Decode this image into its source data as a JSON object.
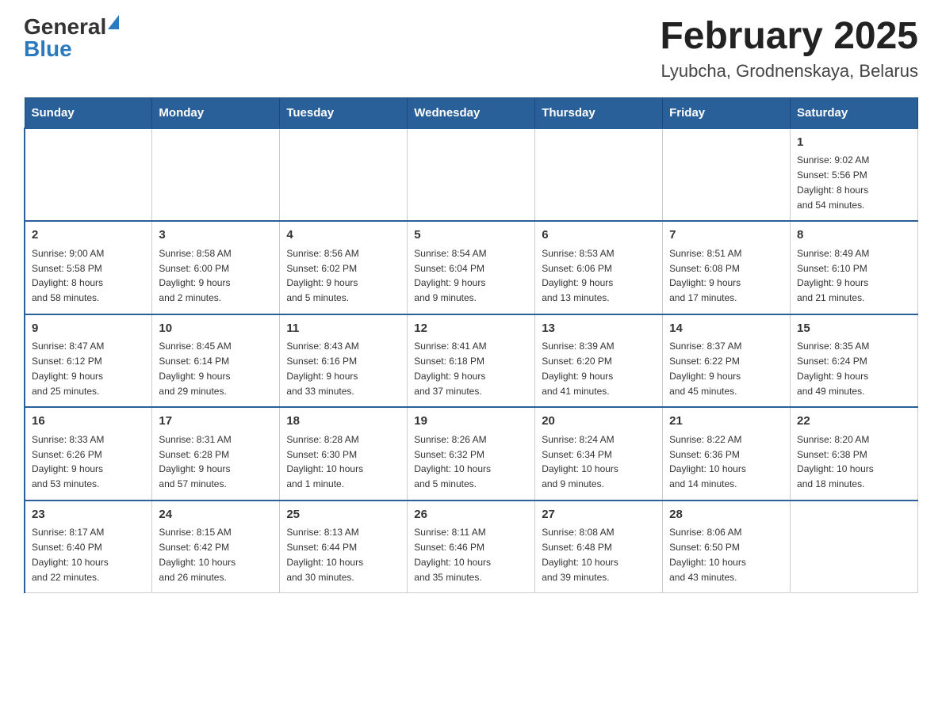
{
  "logo": {
    "general": "General",
    "blue": "Blue"
  },
  "title": "February 2025",
  "location": "Lyubcha, Grodnenskaya, Belarus",
  "days_of_week": [
    "Sunday",
    "Monday",
    "Tuesday",
    "Wednesday",
    "Thursday",
    "Friday",
    "Saturday"
  ],
  "weeks": [
    [
      {
        "day": "",
        "info": ""
      },
      {
        "day": "",
        "info": ""
      },
      {
        "day": "",
        "info": ""
      },
      {
        "day": "",
        "info": ""
      },
      {
        "day": "",
        "info": ""
      },
      {
        "day": "",
        "info": ""
      },
      {
        "day": "1",
        "info": "Sunrise: 9:02 AM\nSunset: 5:56 PM\nDaylight: 8 hours\nand 54 minutes."
      }
    ],
    [
      {
        "day": "2",
        "info": "Sunrise: 9:00 AM\nSunset: 5:58 PM\nDaylight: 8 hours\nand 58 minutes."
      },
      {
        "day": "3",
        "info": "Sunrise: 8:58 AM\nSunset: 6:00 PM\nDaylight: 9 hours\nand 2 minutes."
      },
      {
        "day": "4",
        "info": "Sunrise: 8:56 AM\nSunset: 6:02 PM\nDaylight: 9 hours\nand 5 minutes."
      },
      {
        "day": "5",
        "info": "Sunrise: 8:54 AM\nSunset: 6:04 PM\nDaylight: 9 hours\nand 9 minutes."
      },
      {
        "day": "6",
        "info": "Sunrise: 8:53 AM\nSunset: 6:06 PM\nDaylight: 9 hours\nand 13 minutes."
      },
      {
        "day": "7",
        "info": "Sunrise: 8:51 AM\nSunset: 6:08 PM\nDaylight: 9 hours\nand 17 minutes."
      },
      {
        "day": "8",
        "info": "Sunrise: 8:49 AM\nSunset: 6:10 PM\nDaylight: 9 hours\nand 21 minutes."
      }
    ],
    [
      {
        "day": "9",
        "info": "Sunrise: 8:47 AM\nSunset: 6:12 PM\nDaylight: 9 hours\nand 25 minutes."
      },
      {
        "day": "10",
        "info": "Sunrise: 8:45 AM\nSunset: 6:14 PM\nDaylight: 9 hours\nand 29 minutes."
      },
      {
        "day": "11",
        "info": "Sunrise: 8:43 AM\nSunset: 6:16 PM\nDaylight: 9 hours\nand 33 minutes."
      },
      {
        "day": "12",
        "info": "Sunrise: 8:41 AM\nSunset: 6:18 PM\nDaylight: 9 hours\nand 37 minutes."
      },
      {
        "day": "13",
        "info": "Sunrise: 8:39 AM\nSunset: 6:20 PM\nDaylight: 9 hours\nand 41 minutes."
      },
      {
        "day": "14",
        "info": "Sunrise: 8:37 AM\nSunset: 6:22 PM\nDaylight: 9 hours\nand 45 minutes."
      },
      {
        "day": "15",
        "info": "Sunrise: 8:35 AM\nSunset: 6:24 PM\nDaylight: 9 hours\nand 49 minutes."
      }
    ],
    [
      {
        "day": "16",
        "info": "Sunrise: 8:33 AM\nSunset: 6:26 PM\nDaylight: 9 hours\nand 53 minutes."
      },
      {
        "day": "17",
        "info": "Sunrise: 8:31 AM\nSunset: 6:28 PM\nDaylight: 9 hours\nand 57 minutes."
      },
      {
        "day": "18",
        "info": "Sunrise: 8:28 AM\nSunset: 6:30 PM\nDaylight: 10 hours\nand 1 minute."
      },
      {
        "day": "19",
        "info": "Sunrise: 8:26 AM\nSunset: 6:32 PM\nDaylight: 10 hours\nand 5 minutes."
      },
      {
        "day": "20",
        "info": "Sunrise: 8:24 AM\nSunset: 6:34 PM\nDaylight: 10 hours\nand 9 minutes."
      },
      {
        "day": "21",
        "info": "Sunrise: 8:22 AM\nSunset: 6:36 PM\nDaylight: 10 hours\nand 14 minutes."
      },
      {
        "day": "22",
        "info": "Sunrise: 8:20 AM\nSunset: 6:38 PM\nDaylight: 10 hours\nand 18 minutes."
      }
    ],
    [
      {
        "day": "23",
        "info": "Sunrise: 8:17 AM\nSunset: 6:40 PM\nDaylight: 10 hours\nand 22 minutes."
      },
      {
        "day": "24",
        "info": "Sunrise: 8:15 AM\nSunset: 6:42 PM\nDaylight: 10 hours\nand 26 minutes."
      },
      {
        "day": "25",
        "info": "Sunrise: 8:13 AM\nSunset: 6:44 PM\nDaylight: 10 hours\nand 30 minutes."
      },
      {
        "day": "26",
        "info": "Sunrise: 8:11 AM\nSunset: 6:46 PM\nDaylight: 10 hours\nand 35 minutes."
      },
      {
        "day": "27",
        "info": "Sunrise: 8:08 AM\nSunset: 6:48 PM\nDaylight: 10 hours\nand 39 minutes."
      },
      {
        "day": "28",
        "info": "Sunrise: 8:06 AM\nSunset: 6:50 PM\nDaylight: 10 hours\nand 43 minutes."
      },
      {
        "day": "",
        "info": ""
      }
    ]
  ]
}
